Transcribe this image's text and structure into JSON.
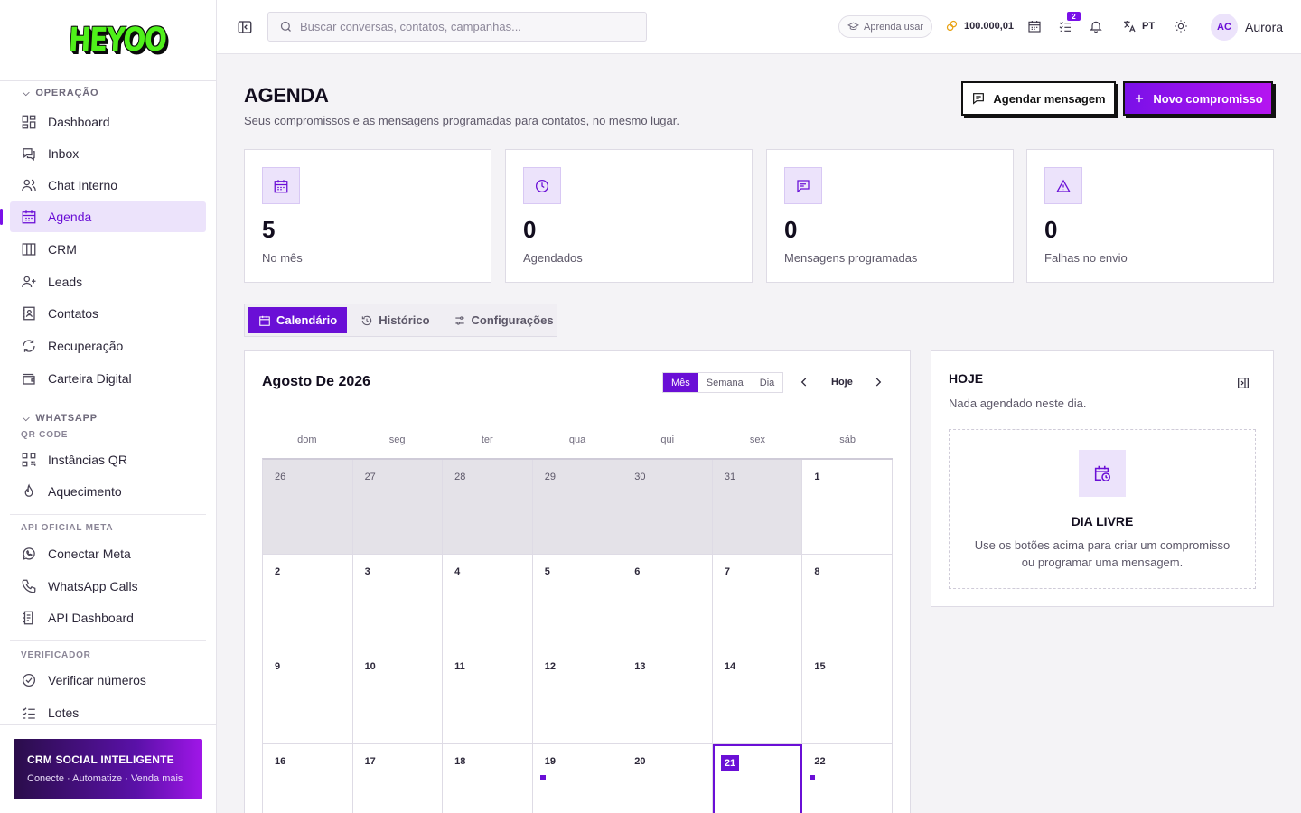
{
  "brand": {
    "logo_text": "HEYOO"
  },
  "sidebar": {
    "sections": {
      "operacao": "OPERAÇÃO",
      "whatsapp": "WHATSAPP",
      "qr_code": "QR CODE",
      "api_oficial": "API OFICIAL META",
      "verificador": "VERIFICADOR"
    },
    "items": [
      {
        "label": "Dashboard",
        "icon": "dashboard-icon"
      },
      {
        "label": "Inbox",
        "icon": "inbox-icon"
      },
      {
        "label": "Chat Interno",
        "icon": "users-icon"
      },
      {
        "label": "Agenda",
        "icon": "calendar-icon",
        "active": true
      },
      {
        "label": "CRM",
        "icon": "kanban-icon"
      },
      {
        "label": "Leads",
        "icon": "user-plus-icon"
      },
      {
        "label": "Contatos",
        "icon": "contact-book-icon"
      },
      {
        "label": "Recuperação",
        "icon": "refresh-icon"
      },
      {
        "label": "Carteira Digital",
        "icon": "wallet-icon"
      },
      {
        "label": "Instâncias QR",
        "icon": "qr-icon"
      },
      {
        "label": "Aquecimento",
        "icon": "flame-icon"
      },
      {
        "label": "Conectar Meta",
        "icon": "whatsapp-icon"
      },
      {
        "label": "WhatsApp Calls",
        "icon": "phone-icon"
      },
      {
        "label": "API Dashboard",
        "icon": "api-doc-icon"
      },
      {
        "label": "Verificar números",
        "icon": "check-circle-icon"
      },
      {
        "label": "Lotes",
        "icon": "list-check-icon"
      }
    ],
    "promo": {
      "title": "CRM SOCIAL INTELIGENTE",
      "subtitle": "Conecte · Automatize · Venda mais"
    }
  },
  "topbar": {
    "search_placeholder": "Buscar conversas, contatos, campanhas...",
    "learn_label": "Aprenda usar",
    "credits": "100.000,01",
    "tasks_badge": "2",
    "language": "PT",
    "avatar_initials": "AC",
    "username": "Aurora"
  },
  "page": {
    "title": "AGENDA",
    "subtitle": "Seus compromissos e as mensagens programadas para contatos, no mesmo lugar.",
    "schedule_message_label": "Agendar mensagem",
    "new_appointment_label": "Novo compromisso"
  },
  "stats": [
    {
      "value": "5",
      "label": "No mês",
      "icon": "calendar-icon"
    },
    {
      "value": "0",
      "label": "Agendados",
      "icon": "clock-icon"
    },
    {
      "value": "0",
      "label": "Mensagens programadas",
      "icon": "message-icon"
    },
    {
      "value": "0",
      "label": "Falhas no envio",
      "icon": "warning-icon"
    }
  ],
  "tabs": [
    {
      "label": "Calendário",
      "active": true
    },
    {
      "label": "Histórico"
    },
    {
      "label": "Configurações"
    }
  ],
  "calendar": {
    "title": "Agosto De 2026",
    "views": [
      "Mês",
      "Semana",
      "Dia"
    ],
    "active_view": "Mês",
    "today_label": "Hoje",
    "weekdays": [
      "dom",
      "seg",
      "ter",
      "qua",
      "qui",
      "sex",
      "sáb"
    ],
    "days": [
      {
        "n": "26",
        "outside": true
      },
      {
        "n": "27",
        "outside": true
      },
      {
        "n": "28",
        "outside": true
      },
      {
        "n": "29",
        "outside": true
      },
      {
        "n": "30",
        "outside": true
      },
      {
        "n": "31",
        "outside": true
      },
      {
        "n": "1"
      },
      {
        "n": "2"
      },
      {
        "n": "3"
      },
      {
        "n": "4"
      },
      {
        "n": "5"
      },
      {
        "n": "6"
      },
      {
        "n": "7"
      },
      {
        "n": "8"
      },
      {
        "n": "9"
      },
      {
        "n": "10"
      },
      {
        "n": "11"
      },
      {
        "n": "12"
      },
      {
        "n": "13"
      },
      {
        "n": "14"
      },
      {
        "n": "15"
      },
      {
        "n": "16"
      },
      {
        "n": "17"
      },
      {
        "n": "18"
      },
      {
        "n": "19",
        "event": true
      },
      {
        "n": "20"
      },
      {
        "n": "21",
        "today": true
      },
      {
        "n": "22",
        "event": true
      }
    ]
  },
  "today_panel": {
    "title": "HOJE",
    "subtitle": "Nada agendado neste dia.",
    "empty_title": "DIA LIVRE",
    "empty_desc": "Use os botões acima para criar um compromisso ou programar uma mensagem."
  }
}
